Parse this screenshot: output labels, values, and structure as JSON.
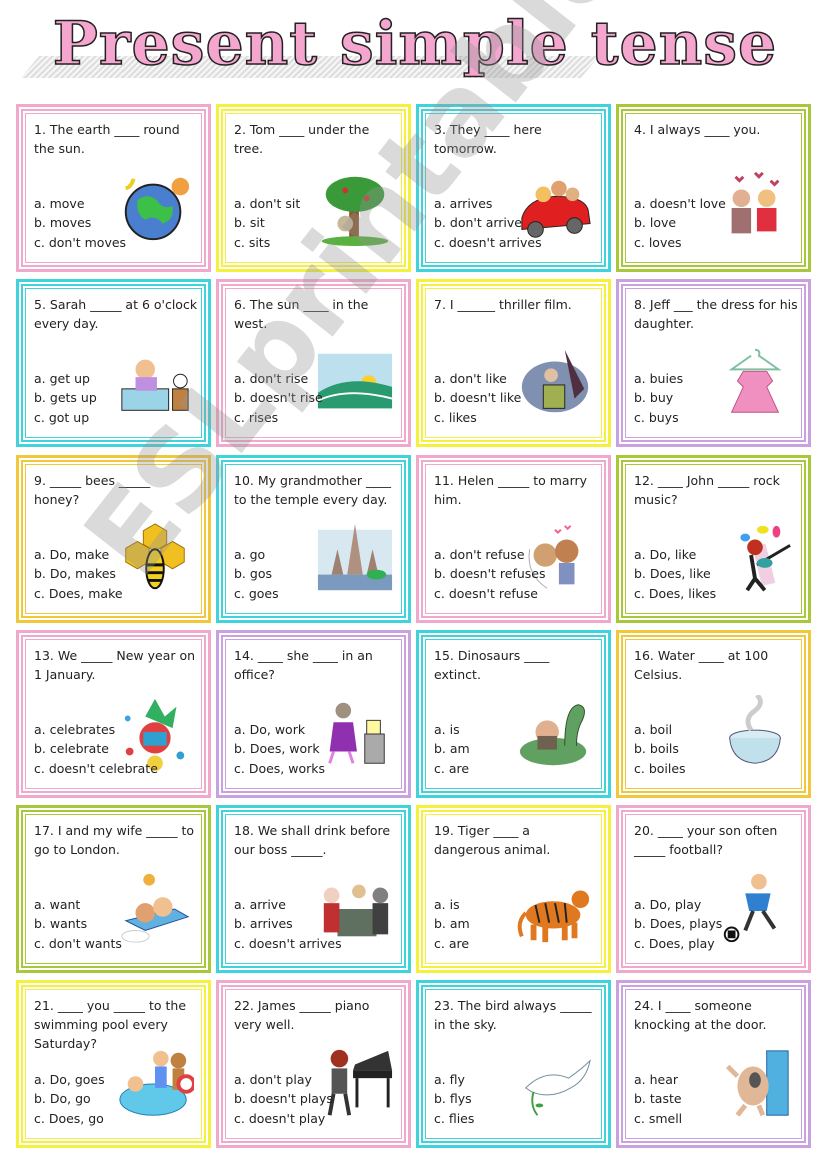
{
  "title": "Present simple tense",
  "watermark": "ESLprintables.com",
  "colors": {
    "pink": "#f0a8cc",
    "yellow": "#f5f03a",
    "cyan": "#3fd3dc",
    "green": "#a8c83a",
    "purple": "#c9a0e0",
    "gold": "#f0c83a"
  },
  "questions": [
    {
      "number": "1",
      "text": "1. The earth ____ round the sun.",
      "options": [
        "a. move",
        "b. moves",
        "c. don't moves"
      ],
      "image": "earth-icon",
      "color": "pink"
    },
    {
      "number": "2",
      "text": "2. Tom ____ under the tree.",
      "options": [
        "a. don't sit",
        "b. sit",
        "c. sits"
      ],
      "image": "tree-icon",
      "color": "yellow"
    },
    {
      "number": "3",
      "text": "3. They ____ here tomorrow.",
      "options": [
        "a. arrives",
        "b. don't arrive",
        "c. doesn't arrives"
      ],
      "image": "car-icon",
      "color": "cyan"
    },
    {
      "number": "4",
      "text": "4. I always ____ you.",
      "options": [
        "a. doesn't love",
        "b. love",
        "c. loves"
      ],
      "image": "couple-icon",
      "color": "green"
    },
    {
      "number": "5",
      "text": "5. Sarah _____ at 6 o'clock every day.",
      "options": [
        "a. get up",
        "b. gets up",
        "c. got up"
      ],
      "image": "bed-icon",
      "color": "cyan"
    },
    {
      "number": "6",
      "text": "6. The sun ____ in the west.",
      "options": [
        "a. don't rise",
        "b. doesn't rise",
        "c. rises"
      ],
      "image": "sunrise-icon",
      "color": "pink"
    },
    {
      "number": "7",
      "text": "7. I ______ thriller film.",
      "options": [
        "a. don't like",
        "b. doesn't like",
        "c. likes"
      ],
      "image": "thriller-icon",
      "color": "yellow"
    },
    {
      "number": "8",
      "text": "8. Jeff ___ the dress for his daughter.",
      "options": [
        "a. buies",
        "b. buy",
        "c. buys"
      ],
      "image": "dress-icon",
      "color": "purple"
    },
    {
      "number": "9",
      "text": "9. _____ bees _____ honey?",
      "options": [
        "a. Do, make",
        "b. Do, makes",
        "c. Does, make"
      ],
      "image": "bee-icon",
      "color": "gold"
    },
    {
      "number": "10",
      "text": "10. My grandmother ____ to the temple every day.",
      "options": [
        "a. go",
        "b. gos",
        "c. goes"
      ],
      "image": "temple-icon",
      "color": "cyan"
    },
    {
      "number": "11",
      "text": "11. Helen _____ to marry him.",
      "options": [
        "a. don't refuse",
        "b. doesn't refuses",
        "c. doesn't refuse"
      ],
      "image": "wedding-icon",
      "color": "pink"
    },
    {
      "number": "12",
      "text": "12. ____ John _____ rock music?",
      "options": [
        "a. Do, like",
        "b. Does, like",
        "c. Does, likes"
      ],
      "image": "guitar-icon",
      "color": "green"
    },
    {
      "number": "13",
      "text": "13. We _____ New year on 1 January.",
      "options": [
        "a. celebrates",
        "b. celebrate",
        "c. doesn't celebrate"
      ],
      "image": "new-year-icon",
      "color": "pink"
    },
    {
      "number": "14",
      "text": "14. ____ she ____ in an office?",
      "options": [
        "a. Do, work",
        "b. Does, work",
        "c. Does, works"
      ],
      "image": "office-icon",
      "color": "purple"
    },
    {
      "number": "15",
      "text": "15. Dinosaurs ____ extinct.",
      "options": [
        "a. is",
        "b. am",
        "c. are"
      ],
      "image": "dinosaur-icon",
      "color": "cyan"
    },
    {
      "number": "16",
      "text": "16. Water ____ at 100 Celsius.",
      "options": [
        "a. boil",
        "b. boils",
        "c. boiles"
      ],
      "image": "boiling-pot-icon",
      "color": "gold"
    },
    {
      "number": "17",
      "text": "17. I and my wife _____ to go to London.",
      "options": [
        "a. want",
        "b. wants",
        "c. don't wants"
      ],
      "image": "airplane-icon",
      "color": "green"
    },
    {
      "number": "18",
      "text": "18. We shall drink before our boss _____.",
      "options": [
        "a. arrive",
        "b. arrives",
        "c. doesn't arrives"
      ],
      "image": "party-icon",
      "color": "cyan"
    },
    {
      "number": "19",
      "text": "19. Tiger ____ a dangerous animal.",
      "options": [
        "a. is",
        "b. am",
        "c. are"
      ],
      "image": "tiger-icon",
      "color": "yellow"
    },
    {
      "number": "20",
      "text": "20. ____ your son often _____ football?",
      "options": [
        "a. Do, play",
        "b. Does, plays",
        "c. Does, play"
      ],
      "image": "football-icon",
      "color": "pink"
    },
    {
      "number": "21",
      "text": "21. ____ you _____ to the swimming pool every Saturday?",
      "options": [
        "a. Do, goes",
        "b. Do, go",
        "c. Does, go"
      ],
      "image": "pool-icon",
      "color": "yellow"
    },
    {
      "number": "22",
      "text": "22. James _____ piano very well.",
      "options": [
        "a. don't play",
        "b. doesn't plays",
        "c. doesn't play"
      ],
      "image": "piano-icon",
      "color": "pink"
    },
    {
      "number": "23",
      "text": "23. The bird always _____ in the sky.",
      "options": [
        "a. fly",
        "b. flys",
        "c. flies"
      ],
      "image": "dove-icon",
      "color": "cyan"
    },
    {
      "number": "24",
      "text": "24. I ____ someone knocking at the door.",
      "options": [
        "a. hear",
        "b. taste",
        "c. smell"
      ],
      "image": "door-icon",
      "color": "purple"
    }
  ]
}
